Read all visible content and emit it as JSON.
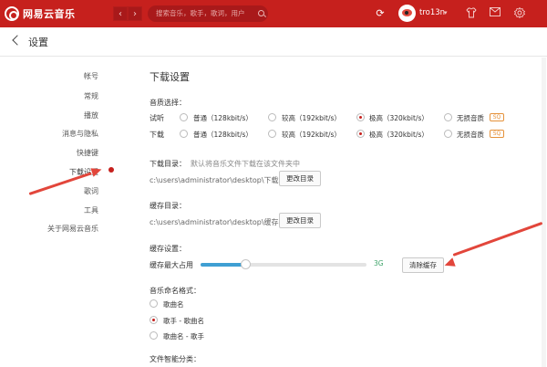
{
  "app": {
    "name": "网易云音乐"
  },
  "topbar": {
    "back_arrow": "‹",
    "forward_arrow": "›",
    "search_placeholder": "搜索音乐，歌手，歌词，用户",
    "username": "tro13n",
    "caret": "▾"
  },
  "page": {
    "title": "设置"
  },
  "sidenav": {
    "items": [
      {
        "label": "帐号"
      },
      {
        "label": "常规"
      },
      {
        "label": "播放"
      },
      {
        "label": "消息与隐私"
      },
      {
        "label": "快捷键"
      },
      {
        "label": "下载设置"
      },
      {
        "label": "歌词"
      },
      {
        "label": "工具"
      },
      {
        "label": "关于网易云音乐"
      }
    ],
    "active_index": 5
  },
  "download": {
    "title": "下载设置",
    "quality_label": "音质选择：",
    "rows": [
      {
        "label": "试听",
        "selected": 2
      },
      {
        "label": "下载",
        "selected": 2
      }
    ],
    "options": [
      {
        "label": "普通（128kbit/s）"
      },
      {
        "label": "较高（192kbit/s）"
      },
      {
        "label": "极高（320kbit/s）"
      },
      {
        "label": "无损音质"
      }
    ],
    "sq_badge": "SQ",
    "dir_label": "下载目录：",
    "dir_hint": "默认将音乐文件下载在该文件夹中",
    "dir_path": "c:\\users\\administrator\\desktop\\下载",
    "change_dir_button": "更改目录",
    "cache_dir_label": "缓存目录：",
    "cache_dir_path": "c:\\users\\administrator\\desktop\\缓存",
    "cache_change_dir_button": "更改目录",
    "cache_settings_label": "缓存设置：",
    "cache_max_label": "缓存最大占用",
    "cache_max_value": "3G",
    "cache_fill_fraction": 0.27,
    "clear_cache_button": "清除缓存",
    "naming_label": "音乐命名格式：",
    "naming_options": [
      {
        "label": "歌曲名"
      },
      {
        "label": "歌手 - 歌曲名"
      },
      {
        "label": "歌曲名 - 歌手"
      }
    ],
    "naming_selected": 1,
    "smart_classify_label": "文件智能分类："
  },
  "colors": {
    "brand": "#c6201d",
    "slider": "#3f9fd3",
    "value_green": "#3fa46a",
    "annotation": "#e2463b"
  }
}
